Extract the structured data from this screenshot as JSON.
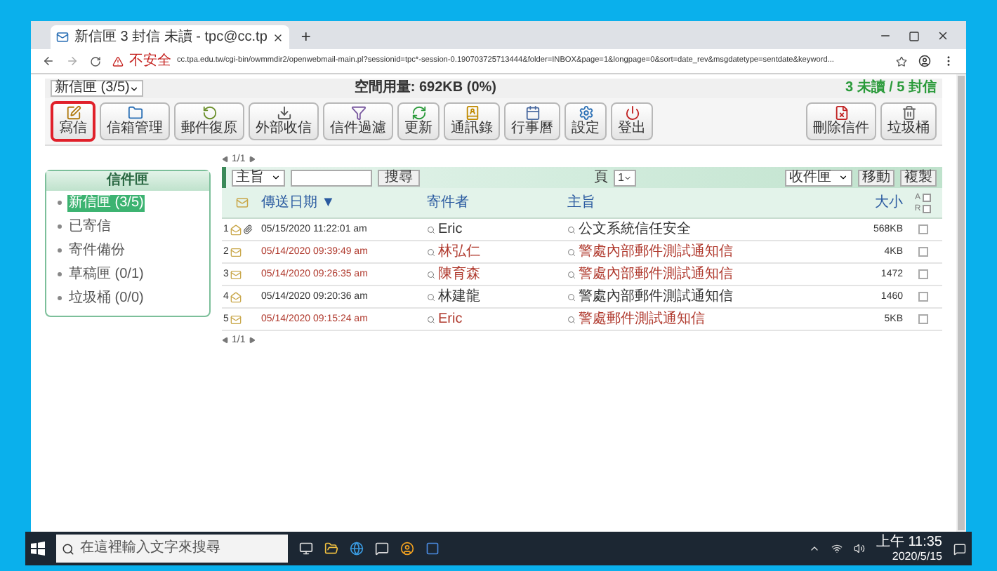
{
  "browser": {
    "tab_title": "新信匣 3 封信 未讀 - tpc@cc.tp",
    "new_tab": "+",
    "security": "不安全",
    "url": "cc.tpa.edu.tw/cgi-bin/owmmdir2/openwebmail-main.pl?sessionid=tpc*-session-0.190703725713444&folder=INBOX&page=1&longpage=0&sort=date_rev&msgdatetype=sentdate&keyword..."
  },
  "mail": {
    "folder_select": "新信匣 (3/5)",
    "quota": "空間用量: 692KB (0%)",
    "summary": "3 未讀 / 5 封信",
    "toolbar": [
      {
        "label": "寫信",
        "kind": "compose",
        "selected": true
      },
      {
        "label": "信箱管理",
        "kind": "folders",
        "selected": false
      },
      {
        "label": "郵件復原",
        "kind": "restore",
        "selected": false
      },
      {
        "label": "外部收信",
        "kind": "fetch",
        "selected": false
      },
      {
        "label": "信件過濾",
        "kind": "filter",
        "selected": false
      },
      {
        "label": "更新",
        "kind": "refresh",
        "selected": false
      },
      {
        "label": "通訊錄",
        "kind": "contacts",
        "selected": false
      },
      {
        "label": "行事曆",
        "kind": "calendar",
        "selected": false
      },
      {
        "label": "設定",
        "kind": "settings",
        "selected": false
      },
      {
        "label": "登出",
        "kind": "logout",
        "selected": false
      }
    ],
    "toolbar_right": [
      {
        "label": "刪除信件",
        "kind": "delete",
        "selected": false
      },
      {
        "label": "垃圾桶",
        "kind": "trash",
        "selected": false
      }
    ],
    "folders_title": "信件匣",
    "folders": [
      {
        "label": "新信匣 (3/5)",
        "selected": true
      },
      {
        "label": "已寄信",
        "selected": false
      },
      {
        "label": "寄件備份",
        "selected": false
      },
      {
        "label": "草稿匣 (0/1)",
        "selected": false
      },
      {
        "label": "垃圾桶 (0/0)",
        "selected": false
      }
    ],
    "pager_top": "1/1",
    "pager_bottom": "1/1",
    "search": {
      "field": "主旨",
      "button": "搜尋"
    },
    "page_label": "頁",
    "page_select": "1",
    "move_target": "收件匣",
    "move_buttons": [
      "移動",
      "複製"
    ],
    "columns": {
      "date": "傳送日期 ▼",
      "sender": "寄件者",
      "subject": "主旨",
      "size": "大小",
      "flags": [
        {
          "label": "A",
          "checked": false
        },
        {
          "label": "R",
          "checked": false
        }
      ]
    },
    "rows": [
      {
        "index": "1",
        "unread": false,
        "attachment": true,
        "date": "05/15/2020 11:22:01 am",
        "sender": "Eric",
        "subject": "公文系統信任安全",
        "size": "568KB",
        "checked": false
      },
      {
        "index": "2",
        "unread": true,
        "attachment": false,
        "date": "05/14/2020 09:39:49 am",
        "sender": "林弘仁",
        "subject": "警處內部郵件測試通知信",
        "size": "4KB",
        "checked": false
      },
      {
        "index": "3",
        "unread": true,
        "attachment": false,
        "date": "05/14/2020 09:26:35 am",
        "sender": "陳育森",
        "subject": "警處內部郵件測試通知信",
        "size": "1472",
        "checked": false
      },
      {
        "index": "4",
        "unread": false,
        "attachment": false,
        "date": "05/14/2020 09:20:36 am",
        "sender": "林建龍",
        "subject": "警處內部郵件測試通知信",
        "size": "1460",
        "checked": false
      },
      {
        "index": "5",
        "unread": true,
        "attachment": false,
        "date": "05/14/2020 09:15:24 am",
        "sender": "Eric",
        "subject": "警處郵件測試通知信",
        "size": "5KB",
        "checked": false
      }
    ]
  },
  "taskbar": {
    "search_placeholder": "在這裡輸入文字來搜尋",
    "time": "上午 11:35",
    "date": "2020/5/15"
  }
}
